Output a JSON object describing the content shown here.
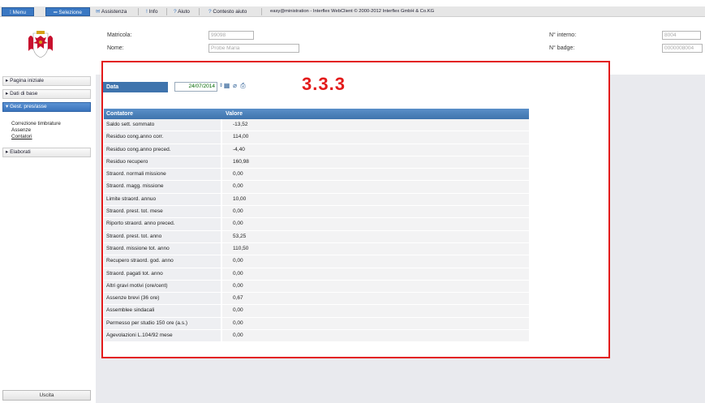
{
  "topbar": {
    "menu_label": "Menu",
    "selection_label": "Selezione",
    "assistance_label": "Assistenza",
    "info_label": "Info",
    "help_label": "Aiuto",
    "context_help_label": "Contesto aiuto",
    "copyright": "easy@ministration - Interflex WebClient © 2000-2012 Interflex GmbH & Co.KG"
  },
  "header": {
    "matricola_label": "Matricola:",
    "matricola_value": "99098",
    "nome_label": "Nome:",
    "nome_value": "Probe Maria",
    "interno_label": "N° interno:",
    "interno_value": "8004",
    "badge_label": "N° badge:",
    "badge_value": "0000008004"
  },
  "sidebar": {
    "items": [
      {
        "label": "Pagina iniziale"
      },
      {
        "label": "Dati di base"
      },
      {
        "label": "Gest. pres/asse"
      },
      {
        "label": "Elaborati"
      }
    ],
    "subitems": [
      "Correzione timbrature",
      "Assenze",
      "Contatori"
    ],
    "exit_label": "Uscita"
  },
  "main": {
    "date_label": "Data",
    "date_value": "24/07/2014",
    "annotation": "3.3.3",
    "table": {
      "headers": [
        "Contatore",
        "Valore"
      ],
      "rows": [
        [
          "Saldo sett. sommato",
          "-13,52"
        ],
        [
          "Residuo cong.anno corr.",
          "114,00"
        ],
        [
          "Residuo cong.anno preced.",
          "-4,40"
        ],
        [
          "Residuo recupero",
          "160,98"
        ],
        [
          "Straord. normali missione",
          "0,00"
        ],
        [
          "Straord. magg. missione",
          "0,00"
        ],
        [
          "Limite straord. annuo",
          "10,00"
        ],
        [
          "Straord. prest. tot. mese",
          "0,00"
        ],
        [
          "Riporto straord. anno preced.",
          "0,00"
        ],
        [
          "Straord. prest. tot. anno",
          "53,25"
        ],
        [
          "Straord. missione tot. anno",
          "110,50"
        ],
        [
          "Recupero straord. god. anno",
          "0,00"
        ],
        [
          "Straord. pagati tot. anno",
          "0,00"
        ],
        [
          "Altri gravi motivi (ore/cent)",
          "0,00"
        ],
        [
          "Assenze brevi (36 ore)",
          "0,67"
        ],
        [
          "Assemblee sindacali",
          "0,00"
        ],
        [
          "Permesso per studio 150 ore (a.s.)",
          "0,00"
        ],
        [
          "Agevolazioni L.104/92 mese",
          "0,00"
        ]
      ]
    }
  },
  "colors": {
    "accent": "#3a78c3",
    "header_blue": "#3f74ad",
    "annotation_red": "#e31b1b"
  }
}
